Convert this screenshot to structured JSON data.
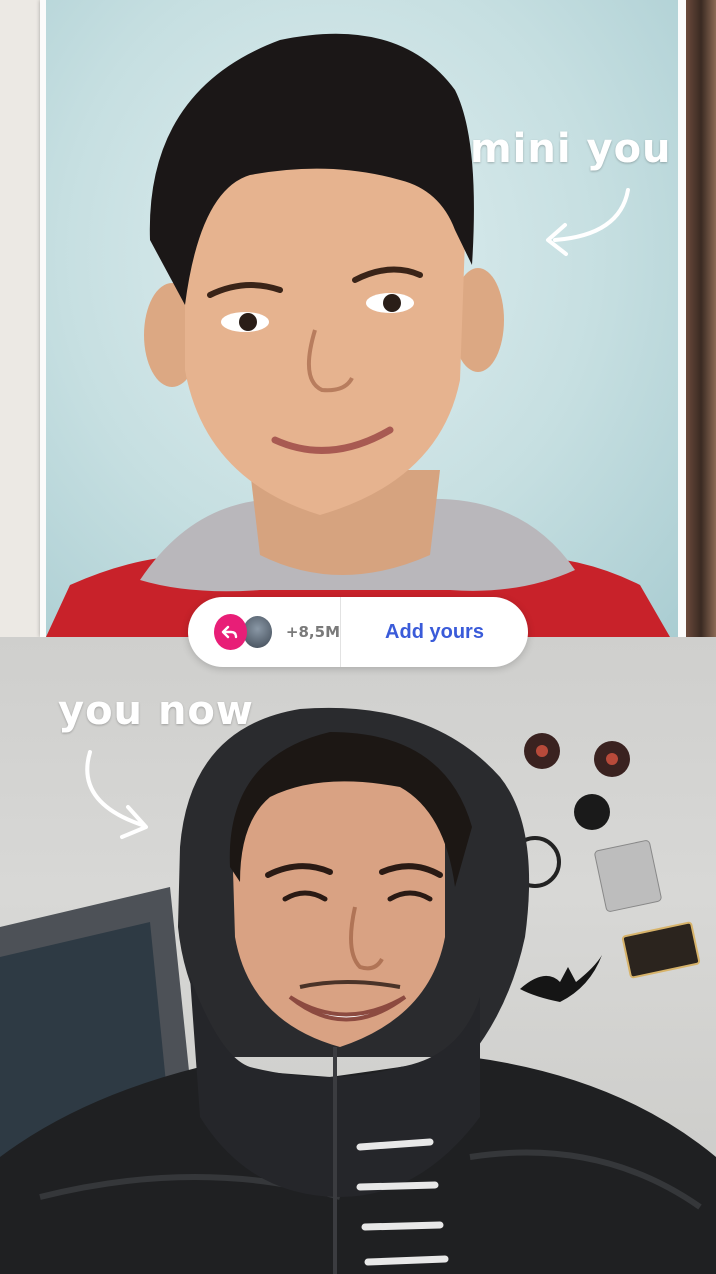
{
  "captions": {
    "top": "mini you",
    "bottom": "you now"
  },
  "add_yours_sticker": {
    "reply_icon": "reply-arrow-icon",
    "participant_count": "+8,5M",
    "button_label": "Add yours",
    "accent_color": "#e81e77",
    "label_color": "#3a5bd9"
  }
}
